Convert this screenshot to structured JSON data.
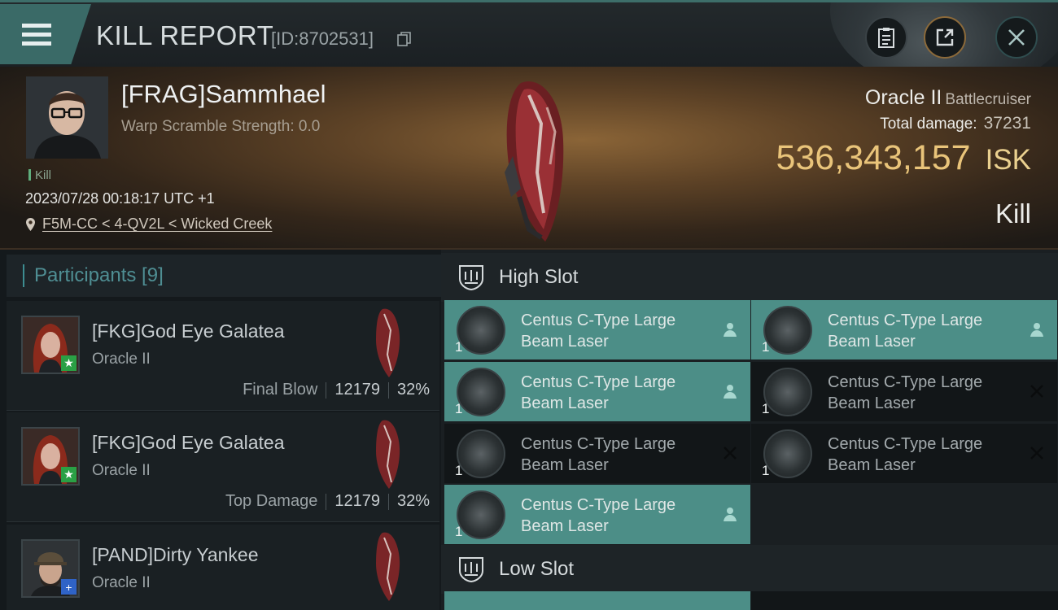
{
  "header": {
    "title": "KILL REPORT",
    "id_text": "[ID:8702531]",
    "buttons": [
      "clipboard-icon",
      "share-icon",
      "close-icon"
    ]
  },
  "victim": {
    "name": "[FRAG]Sammhael",
    "warp_scramble": "Warp Scramble Strength: 0.0",
    "tag": "Kill",
    "datetime": "2023/07/28 00:18:17 UTC +1",
    "location": "F5M-CC < 4-QV2L < Wicked Creek",
    "ship": "Oracle II",
    "ship_class": "Battlecruiser",
    "total_damage_label": "Total damage:",
    "total_damage": "37231",
    "isk_value": "536,343,157",
    "isk_unit": "ISK",
    "result": "Kill"
  },
  "participants": {
    "header": "Participants [9]",
    "rows": [
      {
        "name": "[FKG]God Eye Galatea",
        "ship": "Oracle II",
        "label": "Final Blow",
        "damage": "12179",
        "percent": "32%",
        "badge": "star"
      },
      {
        "name": "[FKG]God Eye Galatea",
        "ship": "Oracle II",
        "label": "Top Damage",
        "damage": "12179",
        "percent": "32%",
        "badge": "star"
      },
      {
        "name": "[PAND]Dirty Yankee",
        "ship": "Oracle II",
        "badge": "plus"
      }
    ]
  },
  "fitting": {
    "high_slot": "High Slot",
    "low_slot": "Low Slot",
    "modules": [
      {
        "line1": "Centus C-Type Large",
        "line2": "Beam Laser",
        "qty": "1",
        "active": true,
        "status": "pilot-icon"
      },
      {
        "line1": "Centus C-Type Large",
        "line2": "Beam Laser",
        "qty": "1",
        "active": true,
        "status": "pilot-icon"
      },
      {
        "line1": "Centus C-Type Large",
        "line2": "Beam Laser",
        "qty": "1",
        "active": true,
        "status": "pilot-icon"
      },
      {
        "line1": "Centus C-Type Large",
        "line2": "Beam Laser",
        "qty": "1",
        "active": false,
        "status": "destroyed-icon"
      },
      {
        "line1": "Centus C-Type Large",
        "line2": "Beam Laser",
        "qty": "1",
        "active": false,
        "status": "destroyed-icon"
      },
      {
        "line1": "Centus C-Type Large",
        "line2": "Beam Laser",
        "qty": "1",
        "active": false,
        "status": "destroyed-icon"
      },
      {
        "line1": "Centus C-Type Large",
        "line2": "Beam Laser",
        "qty": "1",
        "active": true,
        "status": "pilot-icon"
      }
    ]
  },
  "colors": {
    "accent_teal": "#4c8e87",
    "isk_gold": "#e9c47a",
    "participants_header": "#4f8e93"
  }
}
